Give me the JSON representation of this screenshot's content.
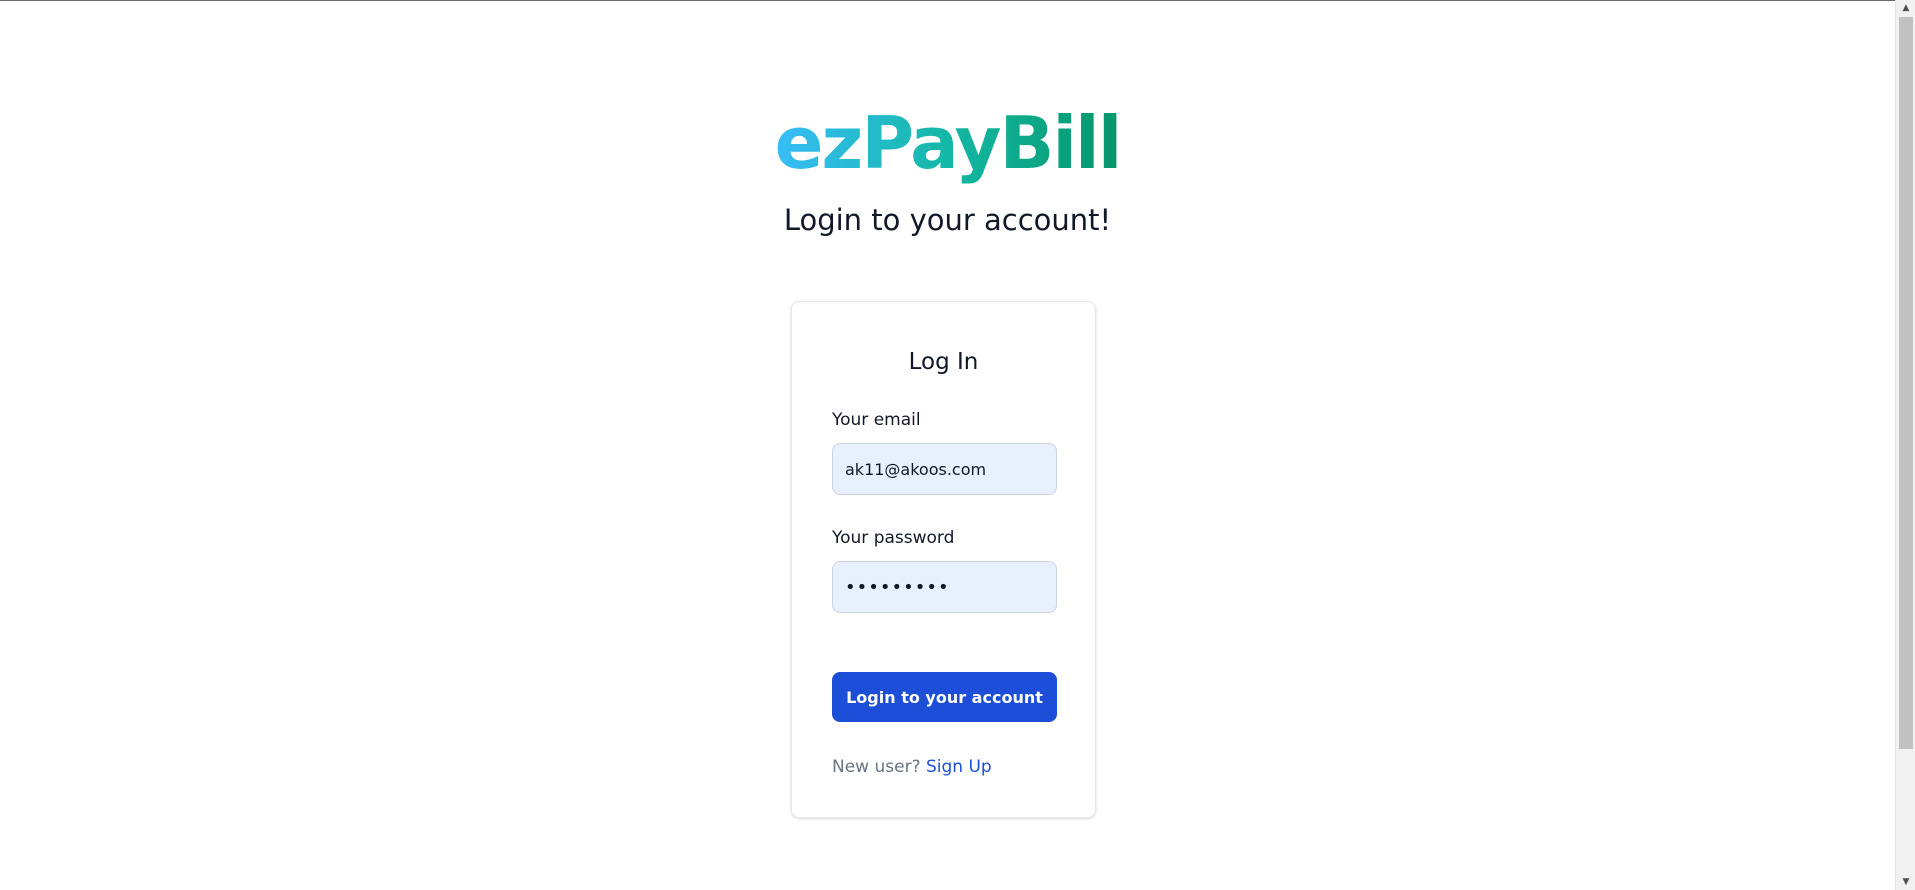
{
  "brand": {
    "name": "ezPayBill",
    "gradient_colors": [
      "#38bdf8",
      "#14b8a6",
      "#059669"
    ]
  },
  "subtitle": "Login to your account!",
  "login_card": {
    "title": "Log In",
    "email": {
      "label": "Your email",
      "value": "ak11@akoos.com"
    },
    "password": {
      "label": "Your password",
      "value": "•••••••••"
    },
    "submit_label": "Login to your account",
    "signup_prompt": "New user?",
    "signup_link": "Sign Up"
  },
  "colors": {
    "primary": "#1d4ed8",
    "input_bg": "#e8f0fe",
    "muted_text": "#6b7280"
  },
  "scrollbar": {
    "up_icon": "scroll-up-arrow",
    "down_icon": "scroll-down-arrow"
  }
}
